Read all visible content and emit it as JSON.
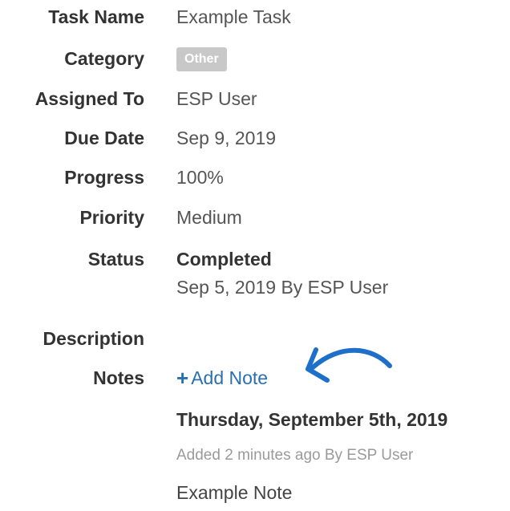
{
  "fields": {
    "task_name": {
      "label": "Task Name",
      "value": "Example Task"
    },
    "category": {
      "label": "Category",
      "badge": "Other"
    },
    "assigned_to": {
      "label": "Assigned To",
      "value": "ESP User"
    },
    "due_date": {
      "label": "Due Date",
      "value": "Sep 9, 2019"
    },
    "progress": {
      "label": "Progress",
      "value": "100%"
    },
    "priority": {
      "label": "Priority",
      "value": "Medium"
    },
    "status": {
      "label": "Status",
      "value": "Completed",
      "detail": "Sep 5, 2019 By ESP User"
    },
    "description": {
      "label": "Description"
    },
    "notes": {
      "label": "Notes",
      "add_label": "Add Note"
    }
  },
  "note": {
    "date": "Thursday, September 5th, 2019",
    "meta": "Added 2 minutes ago By ESP User",
    "text": "Example Note"
  },
  "icons": {
    "add": "plus-icon",
    "annotation": "curved-arrow-icon"
  },
  "colors": {
    "link": "#2a6fb0",
    "badge_bg": "#c8c8c8",
    "arrow": "#1e6fc9"
  }
}
